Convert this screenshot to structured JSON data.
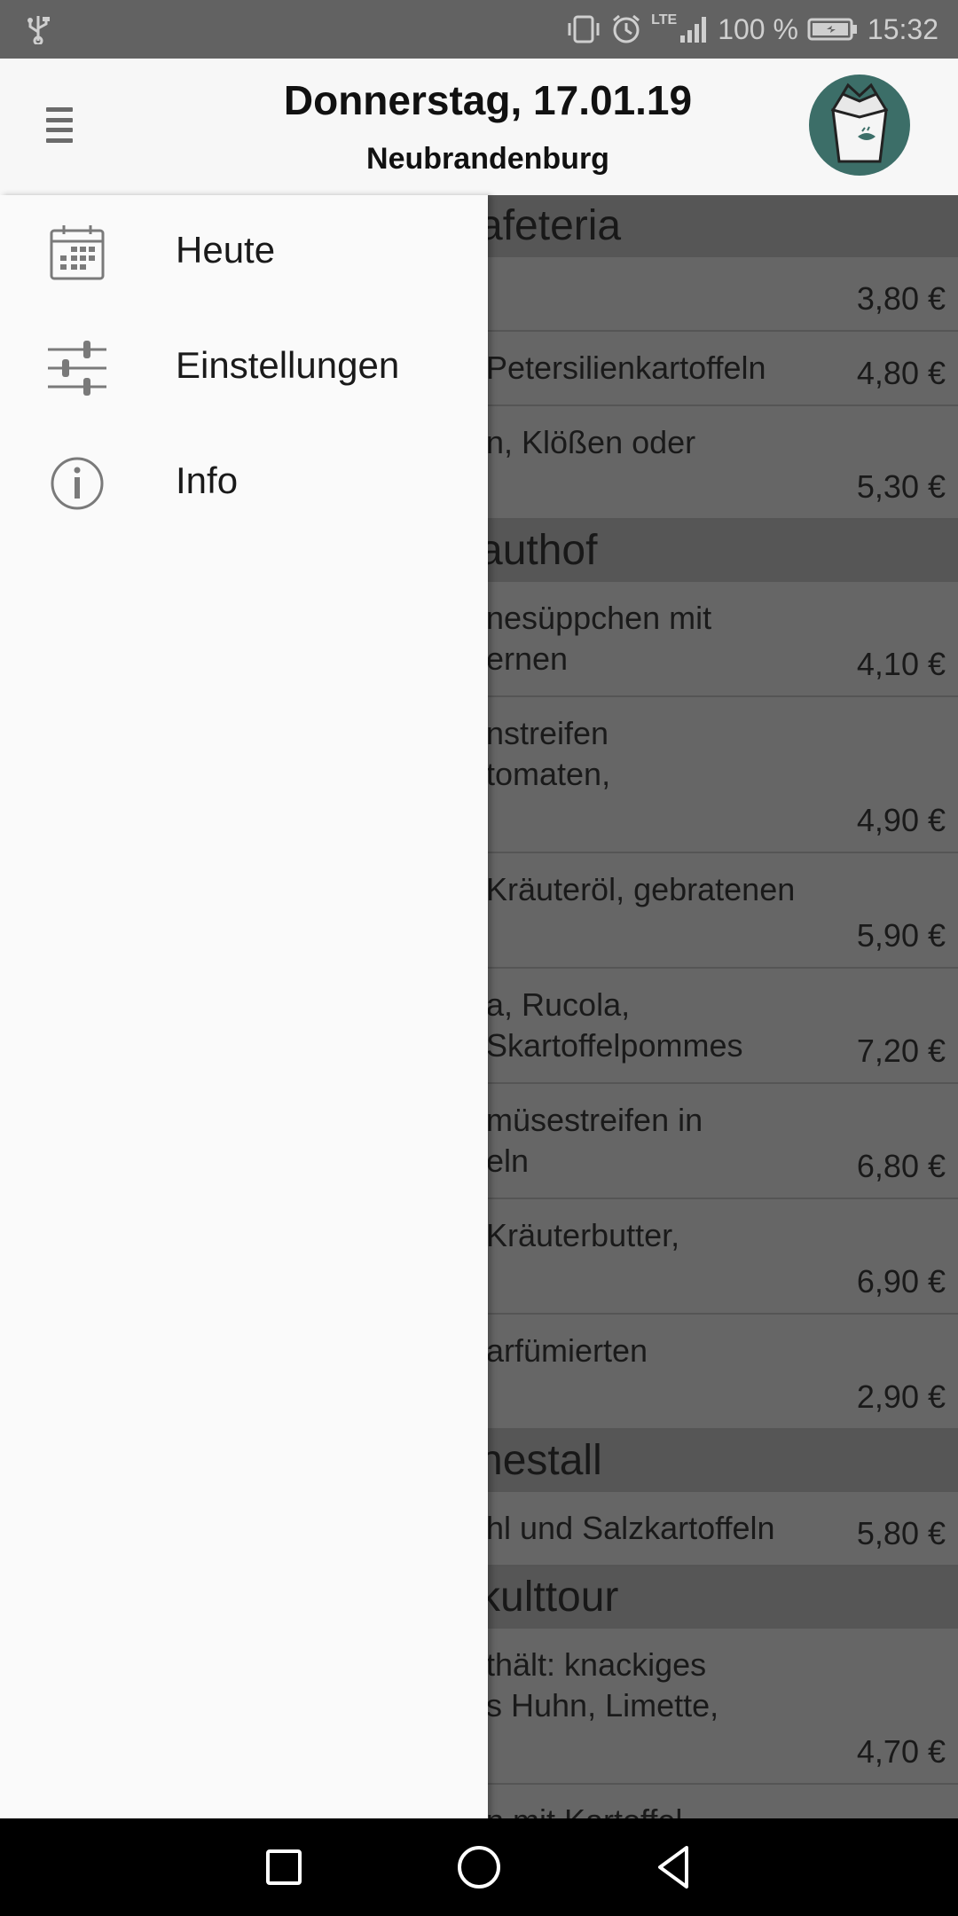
{
  "status_bar": {
    "battery_percent": "100 %",
    "time": "15:32",
    "network": "LTE",
    "icons": [
      "usb-icon",
      "vibrate-icon",
      "alarm-icon",
      "signal-icon",
      "battery-icon"
    ]
  },
  "app_bar": {
    "title": "Donnerstag, 17.01.19",
    "subtitle": "Neubrandenburg",
    "menu_icon": "menu-icon",
    "logo": "takeout-box-logo"
  },
  "drawer": {
    "items": [
      {
        "label": "Heute",
        "icon": "calendar-icon"
      },
      {
        "label": "Einstellungen",
        "icon": "sliders-icon"
      },
      {
        "label": "Info",
        "icon": "info-icon"
      }
    ]
  },
  "menu": {
    "sections": [
      {
        "header": "afeteria",
        "rows": [
          {
            "desc": "",
            "price": "3,80 €"
          },
          {
            "desc": "Petersilienkartoffeln",
            "price": "4,80 €"
          },
          {
            "desc": "n, Klößen oder",
            "price": "5,30 €"
          }
        ]
      },
      {
        "header": "authof",
        "rows": [
          {
            "desc": "nesüppchen mit\nernen",
            "price": "4,10 €"
          },
          {
            "desc": "nstreifen\ntomaten,",
            "price": "4,90 €"
          },
          {
            "desc": "Kräuteröl, gebratenen",
            "price": "5,90 €"
          },
          {
            "desc": "a, Rucola,\nSkartoffelpommes",
            "price": "7,20 €"
          },
          {
            "desc": "müsestreifen in\neln",
            "price": "6,80 €"
          },
          {
            "desc": "Kräuterbutter,",
            "price": "6,90 €"
          },
          {
            "desc": "arfümierten",
            "price": "2,90 €"
          }
        ]
      },
      {
        "header": "nestall",
        "rows": [
          {
            "desc": "hl und Salzkartoffeln",
            "price": "5,80 €"
          }
        ]
      },
      {
        "header": "kulttour",
        "rows": [
          {
            "desc": "thält: knackiges\ns Huhn, Limette,",
            "price": "4,70 €"
          },
          {
            "desc": "n mit Kartoffel-",
            "price": ""
          }
        ]
      }
    ]
  },
  "nav_bar": {
    "buttons": [
      "recents-button",
      "home-button",
      "back-button"
    ]
  }
}
